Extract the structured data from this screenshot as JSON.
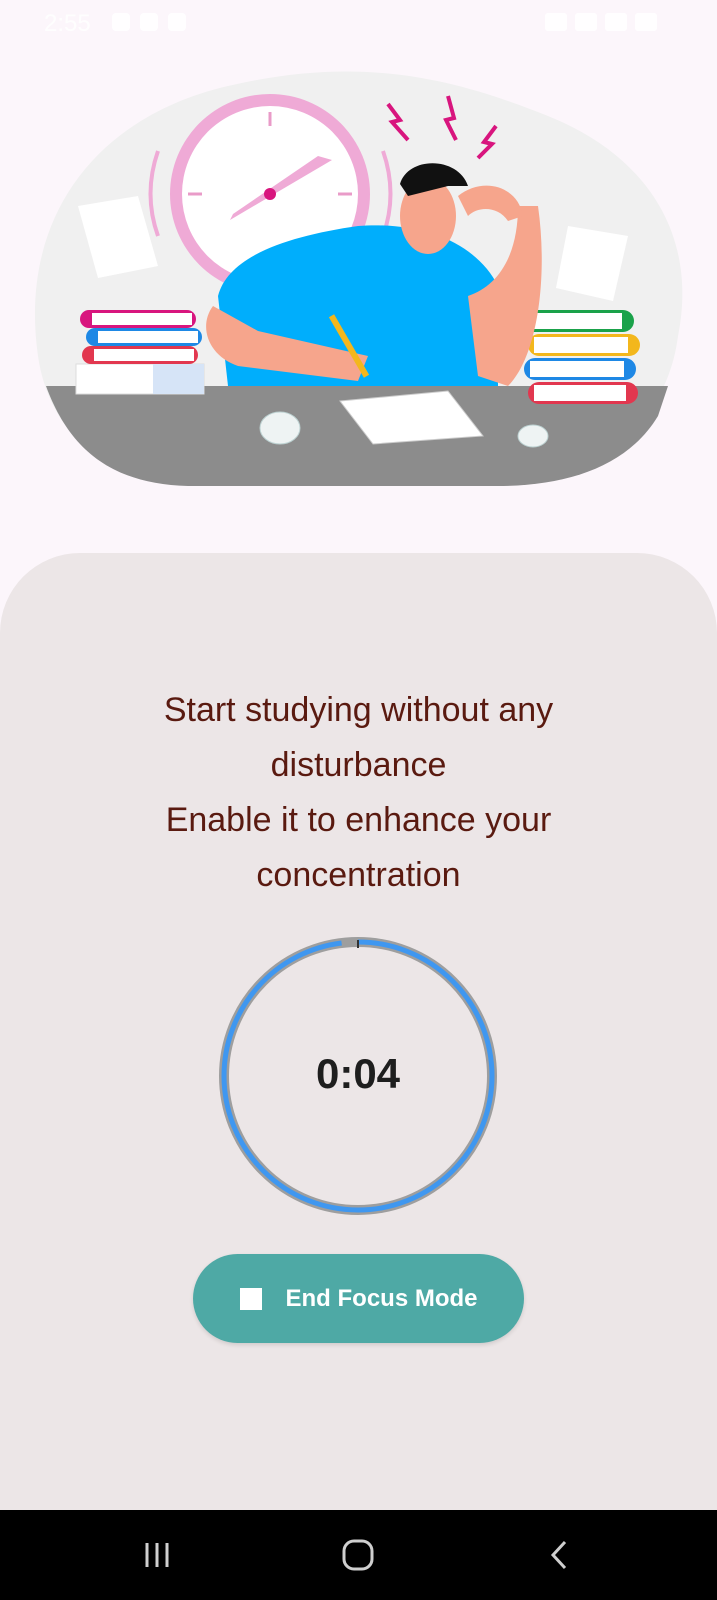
{
  "status_bar": {
    "time": "2:55"
  },
  "message": {
    "line1": "Start studying without any",
    "line2": "disturbance",
    "line3": "Enable it to enhance your",
    "line4": "concentration"
  },
  "timer": {
    "display": "0:04",
    "progress_fraction": 0.02
  },
  "end_button": {
    "label": "End Focus Mode",
    "icon": "stop-icon"
  },
  "nav_bar": {
    "icons": [
      "recent-apps-icon",
      "home-icon",
      "back-icon"
    ]
  },
  "colors": {
    "background": "#fcf6fb",
    "panel": "#ece6e7",
    "message_text": "#5a1a10",
    "timer_track": "#9e9e9e",
    "timer_ring": "#3f97f0",
    "button": "#4ea9a5",
    "nav_bar": "#000000"
  }
}
